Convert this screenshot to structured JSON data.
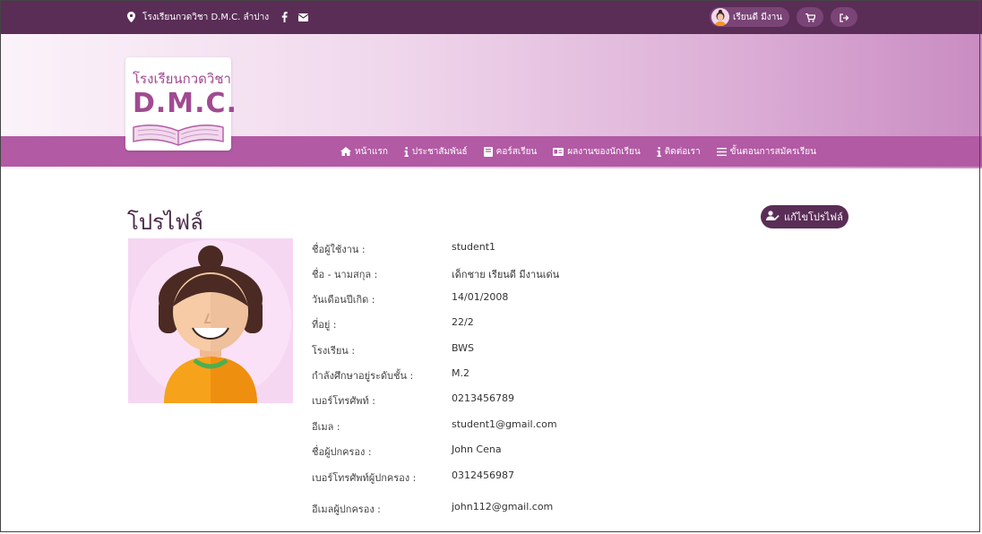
{
  "topbar": {
    "school_location": "โรงเรียนกวดวิชา D.M.C. ลำปาง",
    "username": "เรียนดี มีงาน"
  },
  "logo": {
    "line1": "โรงเรียนกวดวิชา",
    "line2": "D.M.C."
  },
  "nav": {
    "items": [
      {
        "label": "หน้าแรก",
        "icon": "home-icon"
      },
      {
        "label": "ประชาสัมพันธ์",
        "icon": "info-icon"
      },
      {
        "label": "คอร์สเรียน",
        "icon": "book-icon"
      },
      {
        "label": "ผลงานของนักเรียน",
        "icon": "id-card-icon"
      },
      {
        "label": "ติดต่อเรา",
        "icon": "info-icon"
      },
      {
        "label": "ขั้นตอนการสมัครเรียน",
        "icon": "list-icon"
      }
    ]
  },
  "profile": {
    "title": "โปรไฟล์",
    "edit_label": "แก้ไขโปรไฟล์",
    "fields": [
      {
        "label": "ชื่อผู้ใช้งาน :",
        "value": "student1"
      },
      {
        "label": "ชื่อ - นามสกุล :",
        "value": "เด็กชาย เรียนดี มีงานเด่น"
      },
      {
        "label": "วันเดือนปีเกิด :",
        "value": "14/01/2008"
      },
      {
        "label": "ที่อยู่ :",
        "value": "22/2"
      },
      {
        "label": "โรงเรียน :",
        "value": "BWS"
      },
      {
        "label": "กำลังศึกษาอยู่ระดับชั้น :",
        "value": "M.2"
      },
      {
        "label": "เบอร์โทรศัพท์ :",
        "value": "0213456789"
      },
      {
        "label": "อีเมล :",
        "value": "student1@gmail.com"
      },
      {
        "label": "ชื่อผู้ปกครอง :",
        "value": "John Cena"
      },
      {
        "label": "เบอร์โทรศัพท์ผู้ปกครอง :",
        "value": "0312456987"
      },
      {
        "label": "อีเมลผู้ปกครอง :",
        "value": "john112@gmail.com"
      }
    ]
  },
  "colors": {
    "topbar": "#5a2d57",
    "navband": "#b25aa4",
    "accent": "#a04a92"
  }
}
